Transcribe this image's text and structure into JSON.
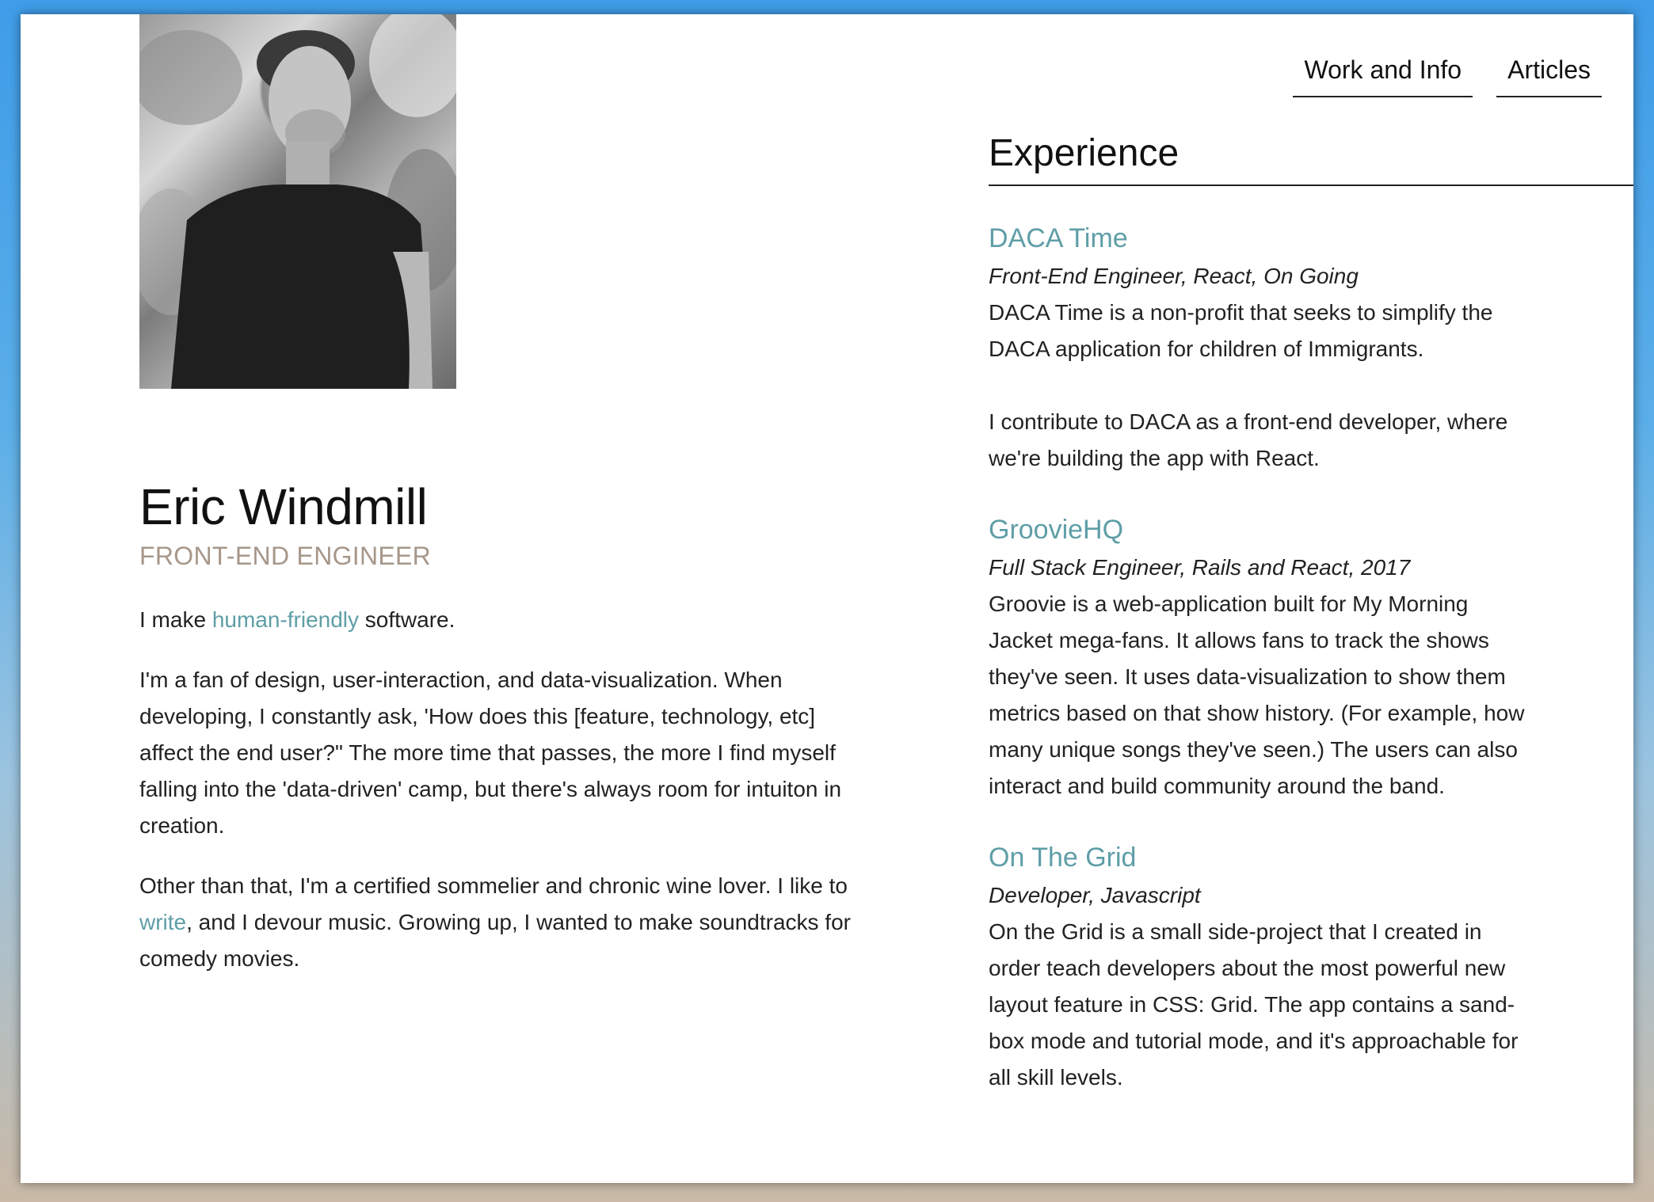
{
  "nav": {
    "work_label": "Work and Info",
    "articles_label": "Articles"
  },
  "profile": {
    "name": "Eric Windmill",
    "title": "FRONT-END ENGINEER",
    "intro_before": "I make ",
    "intro_link": "human-friendly",
    "intro_after": " software.",
    "para2": "I'm a fan of design, user-interaction, and data-visualization. When developing, I constantly ask, 'How does this [feature, technology, etc] affect the end user?\" The more time that passes, the more I find myself falling into the 'data-driven' camp, but there's always room for intuiton in creation.",
    "para3_before": "Other than that, I'm a certified sommelier and chronic wine lover. I like to ",
    "para3_link": "write",
    "para3_after": ", and I devour music. Growing up, I wanted to make soundtracks for comedy movies."
  },
  "experience": {
    "heading": "Experience",
    "jobs": [
      {
        "title": "DACA Time",
        "meta": "Front-End Engineer, React, On Going",
        "desc1": "DACA Time is a non-profit that seeks to simplify the DACA application for children of Immigrants.",
        "desc2": "I contribute to DACA as a front-end developer, where we're building the app with React."
      },
      {
        "title": "GroovieHQ",
        "meta": "Full Stack Engineer, Rails and React, 2017",
        "desc1": "Groovie is a web-application built for My Morning Jacket mega-fans. It allows fans to track the shows they've seen. It uses data-visualization to show them metrics based on that show history. (For example, how many unique songs they've seen.) The users can also interact and build community around the band."
      },
      {
        "title": "On The Grid",
        "meta": "Developer, Javascript",
        "desc1": "On the Grid is a small side-project that I created in order teach developers about the most powerful new layout feature in CSS: Grid. The app contains a sand-box mode and tutorial mode, and it's approachable for all skill levels."
      }
    ]
  },
  "colors": {
    "accent": "#5f9ea7",
    "subtitle": "#a6978a"
  }
}
